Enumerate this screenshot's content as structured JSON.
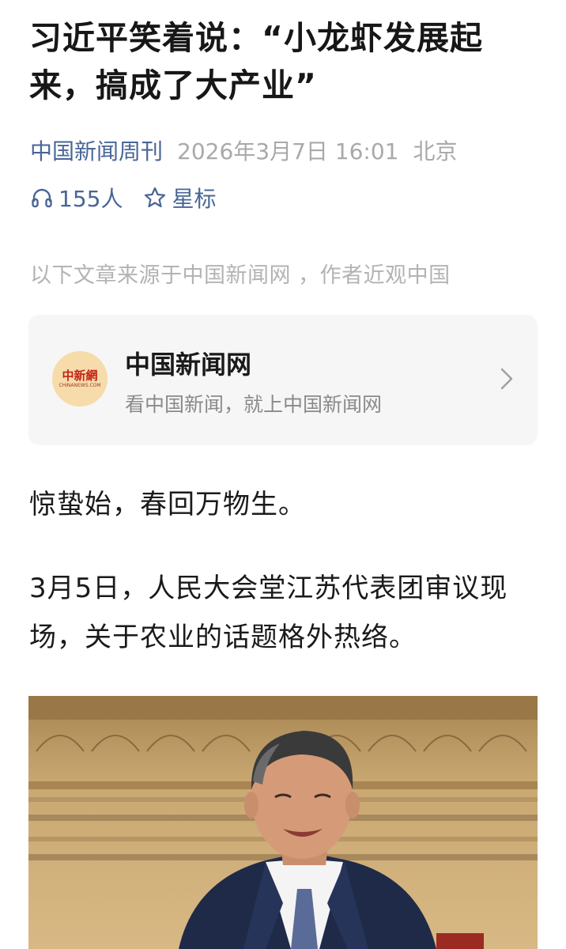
{
  "article": {
    "title": "习近平笑着说：“小龙虾发展起来，搞成了大产业”",
    "source": "中国新闻周刊",
    "date": "2026年3月7日 16:01",
    "location": "北京",
    "listen_count": "155人",
    "star_label": "星标",
    "notice": "以下文章来源于中国新闻网 ，作者近观中国"
  },
  "account_card": {
    "name": "中国新闻网",
    "description": "看中国新闻，就上中国新闻网",
    "logo_text": "中新網",
    "logo_subtext": "CHINANEWS.COM"
  },
  "body": {
    "paragraphs": [
      "惊蛰始，春回万物生。",
      "3月5日，人民大会堂江苏代表团审议现场，关于农业的话题格外热络。"
    ]
  },
  "icons": {
    "listen": "headphones-icon",
    "star": "star-outline-icon",
    "card_arrow": "chevron-right-icon"
  },
  "colors": {
    "link": "#4a6596",
    "meta_gray": "#a9a9a9",
    "card_bg": "#f6f6f6"
  }
}
